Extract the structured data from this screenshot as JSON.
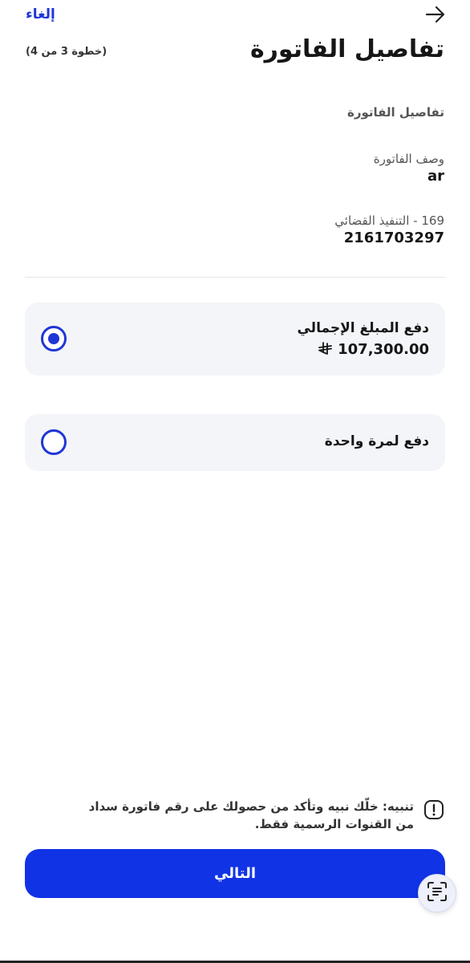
{
  "header": {
    "cancel_label": "إلغاء",
    "title": "تفاصيل الفاتورة",
    "step": "(خطوة 3 من 4)"
  },
  "details": {
    "section_title": "تفاصيل الفاتورة",
    "description_label": "وصف الفاتورة",
    "description_value": "ar",
    "execution_label": "169 - التنفيذ القضائي",
    "execution_value": "2161703297"
  },
  "options": {
    "full": {
      "title": "دفع المبلغ الإجمالي",
      "amount": "107,300.00",
      "currency_symbol": "ر.س",
      "selected": true
    },
    "once": {
      "title": "دفع لمرة واحدة",
      "selected": false
    }
  },
  "warning": {
    "text": "تنبيه: خلّك نبيه وتأكد من حصولك على رقم فاتورة سداد من القنوات الرسمية فقط."
  },
  "footer": {
    "next_label": "التالي"
  },
  "colors": {
    "accent": "#1133e6",
    "card_bg": "#f4f5f8"
  }
}
